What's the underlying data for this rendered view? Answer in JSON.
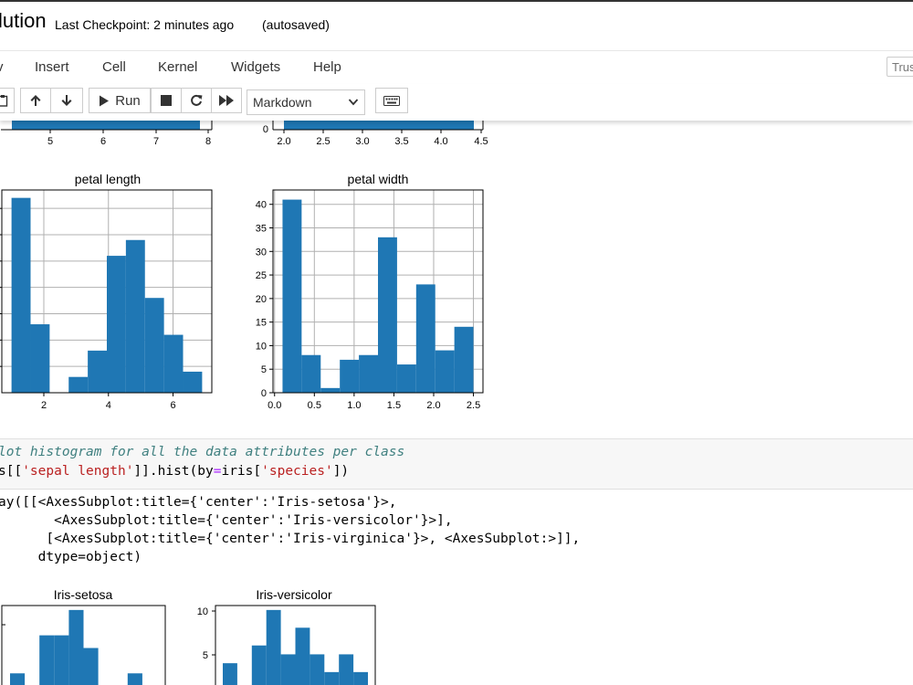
{
  "header": {
    "title": "lution",
    "checkpoint": "Last Checkpoint: 2 minutes ago",
    "autosaved": "(autosaved)"
  },
  "menu": {
    "items": [
      "v",
      "Insert",
      "Cell",
      "Kernel",
      "Widgets",
      "Help"
    ],
    "trusted": "Trus"
  },
  "toolbar": {
    "run_label": "Run",
    "cell_type": "Markdown"
  },
  "plots": {
    "top_left_ticks": [
      "5",
      "6",
      "7",
      "8"
    ],
    "top_right_ticks": [
      "2.0",
      "2.5",
      "3.0",
      "3.5",
      "4.0",
      "4.5"
    ],
    "top_right_y0": "0",
    "petal_length": {
      "title": "petal length",
      "xticks": [
        "2",
        "4",
        "6"
      ],
      "bins": [
        {
          "x0": 1.0,
          "x1": 1.59,
          "v": 37
        },
        {
          "x0": 1.59,
          "x1": 2.18,
          "v": 13
        },
        {
          "x0": 2.18,
          "x1": 2.77,
          "v": 0
        },
        {
          "x0": 2.77,
          "x1": 3.36,
          "v": 3
        },
        {
          "x0": 3.36,
          "x1": 3.95,
          "v": 8
        },
        {
          "x0": 3.95,
          "x1": 4.54,
          "v": 26
        },
        {
          "x0": 4.54,
          "x1": 5.13,
          "v": 29
        },
        {
          "x0": 5.13,
          "x1": 5.72,
          "v": 18
        },
        {
          "x0": 5.72,
          "x1": 6.31,
          "v": 11
        },
        {
          "x0": 6.31,
          "x1": 6.9,
          "v": 4
        }
      ]
    },
    "petal_width": {
      "title": "petal width",
      "xticks": [
        "0.0",
        "0.5",
        "1.0",
        "1.5",
        "2.0",
        "2.5"
      ],
      "yticks": [
        "0",
        "5",
        "10",
        "15",
        "20",
        "25",
        "30",
        "35",
        "40"
      ],
      "bins": [
        {
          "x0": 0.1,
          "x1": 0.34,
          "v": 41
        },
        {
          "x0": 0.34,
          "x1": 0.58,
          "v": 8
        },
        {
          "x0": 0.58,
          "x1": 0.82,
          "v": 1
        },
        {
          "x0": 0.82,
          "x1": 1.06,
          "v": 7
        },
        {
          "x0": 1.06,
          "x1": 1.3,
          "v": 8
        },
        {
          "x0": 1.3,
          "x1": 1.54,
          "v": 33
        },
        {
          "x0": 1.54,
          "x1": 1.78,
          "v": 6
        },
        {
          "x0": 1.78,
          "x1": 2.02,
          "v": 23
        },
        {
          "x0": 2.02,
          "x1": 2.26,
          "v": 9
        },
        {
          "x0": 2.26,
          "x1": 2.5,
          "v": 14
        }
      ]
    },
    "iris_setosa": {
      "title": "Iris-setosa",
      "bins": [
        2,
        0,
        5,
        5,
        7,
        4,
        1,
        0,
        2,
        0
      ]
    },
    "iris_versicolor": {
      "title": "Iris-versicolor",
      "yticks": [
        "5",
        "10"
      ],
      "bins": [
        4,
        1,
        6,
        10,
        5,
        8,
        5,
        3,
        5,
        3
      ]
    }
  },
  "code": {
    "comment": "lot histogram for all the data attributes per class",
    "line2_a": "s[[",
    "line2_str1": "'sepal length'",
    "line2_b": "]].hist(by",
    "line2_op": "=",
    "line2_c": "iris[",
    "line2_str2": "'species'",
    "line2_d": "])"
  },
  "output": {
    "lines": [
      "ay([[<AxesSubplot:title={'center':'Iris-setosa'}>,",
      "       <AxesSubplot:title={'center':'Iris-versicolor'}>],",
      "      [<AxesSubplot:title={'center':'Iris-virginica'}>, <AxesSubplot:>]],",
      "     dtype=object)"
    ]
  },
  "colors": {
    "bar": "#1f77b4",
    "grid": "#b0b0b0"
  }
}
